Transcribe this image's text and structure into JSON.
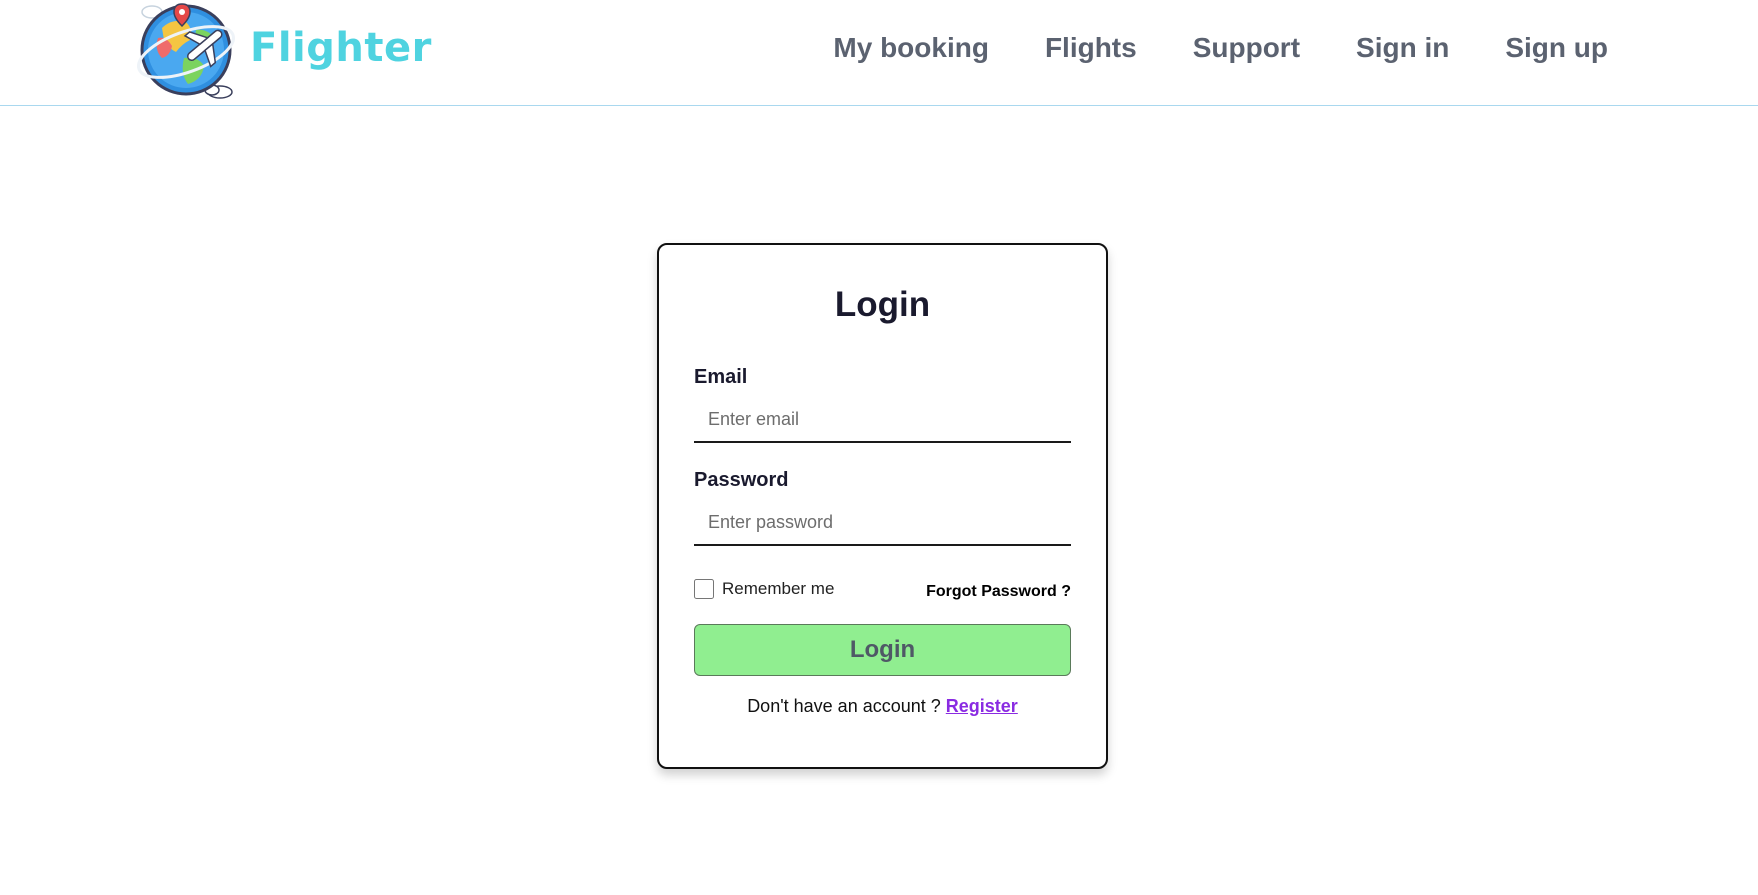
{
  "brand": {
    "name": "Flighter",
    "logo_icon": "globe-airplane-logo-icon"
  },
  "nav": {
    "items": [
      {
        "label": "My booking"
      },
      {
        "label": "Flights"
      },
      {
        "label": "Support"
      },
      {
        "label": "Sign in"
      },
      {
        "label": "Sign up"
      }
    ]
  },
  "login": {
    "title": "Login",
    "email": {
      "label": "Email",
      "placeholder": "Enter email",
      "value": ""
    },
    "password": {
      "label": "Password",
      "placeholder": "Enter password",
      "value": ""
    },
    "remember_label": "Remember me",
    "remember_checked": false,
    "forgot_label": "Forgot Password ?",
    "submit_label": "Login",
    "register_prompt": "Don't have an account ?",
    "register_link": "Register"
  },
  "colors": {
    "brand_text": "#4fd3e0",
    "nav_text": "#5b6270",
    "button_bg": "#90ee90",
    "link": "#8a2be2",
    "divider": "#a9d8ef"
  }
}
